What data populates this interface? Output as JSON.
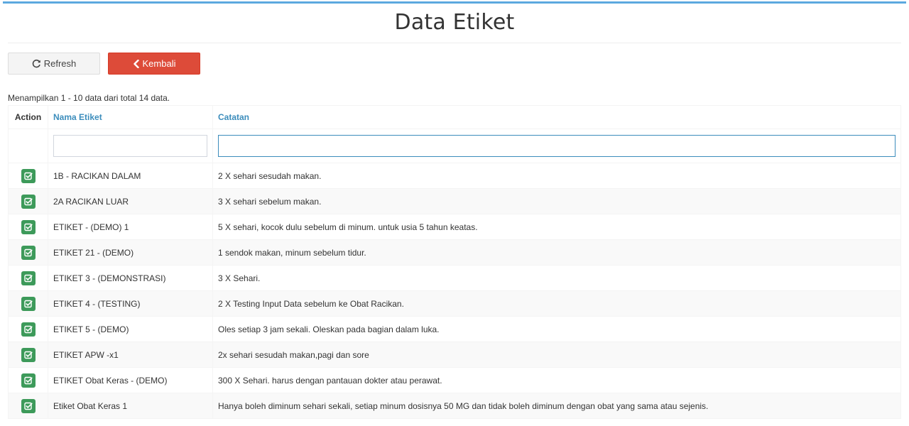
{
  "page": {
    "title": "Data Etiket"
  },
  "toolbar": {
    "refresh_label": "Refresh",
    "back_label": "Kembali",
    "refresh_icon": "refresh-icon",
    "back_icon": "chevron-left-icon"
  },
  "summary": "Menampilkan 1 - 10 data dari total 14 data.",
  "table": {
    "columns": [
      "Action",
      "Nama Etiket",
      "Catatan"
    ],
    "filters": {
      "nama_placeholder": "",
      "catatan_placeholder": ""
    },
    "rows": [
      {
        "nama": "1B - RACIKAN DALAM",
        "catatan": "2 X sehari sesudah makan."
      },
      {
        "nama": "2A RACIKAN LUAR",
        "catatan": "3 X sehari sebelum makan."
      },
      {
        "nama": "ETIKET - (DEMO) 1",
        "catatan": "5 X sehari, kocok dulu sebelum di minum. untuk usia 5 tahun keatas."
      },
      {
        "nama": "ETIKET 21 - (DEMO)",
        "catatan": "1 sendok makan, minum sebelum tidur."
      },
      {
        "nama": "ETIKET 3 - (DEMONSTRASI)",
        "catatan": "3 X Sehari."
      },
      {
        "nama": "ETIKET 4 - (TESTING)",
        "catatan": "2 X Testing Input Data sebelum ke Obat Racikan."
      },
      {
        "nama": "ETIKET 5 - (DEMO)",
        "catatan": "Oles setiap 3 jam sekali. Oleskan pada bagian dalam luka."
      },
      {
        "nama": "ETIKET APW -x1",
        "catatan": "2x sehari sesudah makan,pagi dan sore"
      },
      {
        "nama": "ETIKET Obat Keras - (DEMO)",
        "catatan": "300 X Sehari. harus dengan pantauan dokter atau perawat."
      },
      {
        "nama": "Etiket Obat Keras 1",
        "catatan": "Hanya boleh diminum sehari sekali, setiap minum dosisnya 50 MG dan tidak boleh diminum dengan obat yang sama atau sejenis."
      }
    ]
  },
  "colors": {
    "accent": "#3c8dbc",
    "danger": "#dd4b39",
    "success": "#3d9a5a",
    "top_border": "#5ca9df"
  }
}
